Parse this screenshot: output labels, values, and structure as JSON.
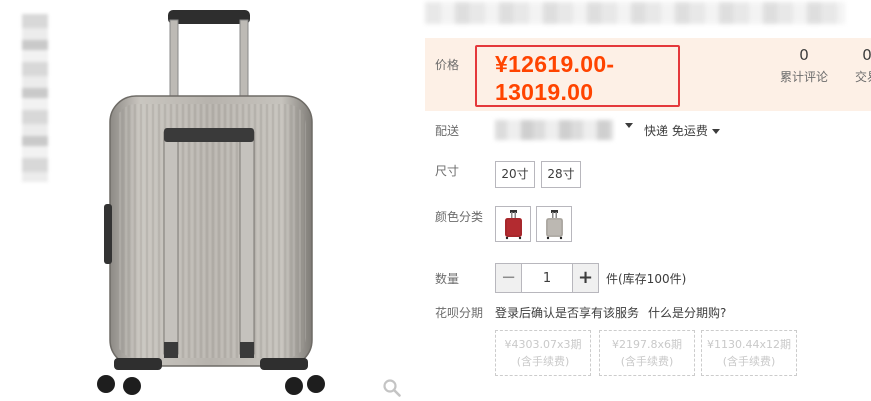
{
  "price": {
    "label": "价格",
    "value": "¥12619.00-13019.00"
  },
  "stats": {
    "reviews_count": "0",
    "reviews_label": "累计评论",
    "deals_count": "0",
    "deals_label": "交易"
  },
  "shipping": {
    "label": "配送",
    "method": "快递 免运费"
  },
  "size": {
    "label": "尺寸",
    "options": [
      "20寸",
      "28寸"
    ]
  },
  "color": {
    "label": "颜色分类",
    "swatches": [
      "red-suitcase",
      "silver-suitcase"
    ]
  },
  "quantity": {
    "label": "数量",
    "minus": "−",
    "value": "1",
    "plus": "+",
    "stock": "件(库存100件)"
  },
  "installment": {
    "label": "花呗分期",
    "note": "登录后确认是否享有该服务",
    "link": "什么是分期购?",
    "plans": [
      {
        "amount": "¥4303.07x3期",
        "fee": "(含手续费)"
      },
      {
        "amount": "¥2197.8x6期",
        "fee": "(含手续费)"
      },
      {
        "amount": "¥1130.44x12期",
        "fee": "(含手续费)"
      }
    ]
  },
  "colors": {
    "price_red": "#f40",
    "highlight_border": "#e4393c",
    "price_bg": "#fdf0e6"
  }
}
